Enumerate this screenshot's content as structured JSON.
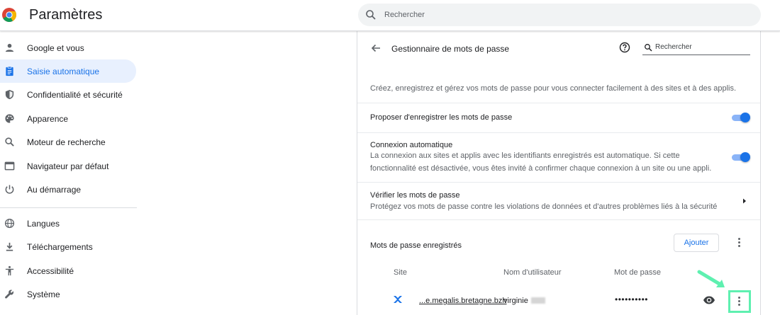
{
  "header": {
    "title": "Paramètres",
    "search_placeholder": "Rechercher"
  },
  "sidebar": {
    "items": [
      {
        "label": "Google et vous",
        "icon": "person-icon"
      },
      {
        "label": "Saisie automatique",
        "icon": "clipboard-icon",
        "active": true
      },
      {
        "label": "Confidentialité et sécurité",
        "icon": "shield-icon"
      },
      {
        "label": "Apparence",
        "icon": "palette-icon"
      },
      {
        "label": "Moteur de recherche",
        "icon": "search-icon"
      },
      {
        "label": "Navigateur par défaut",
        "icon": "browser-icon"
      },
      {
        "label": "Au démarrage",
        "icon": "power-icon"
      },
      {
        "label": "Langues",
        "icon": "globe-icon"
      },
      {
        "label": "Téléchargements",
        "icon": "download-icon"
      },
      {
        "label": "Accessibilité",
        "icon": "accessibility-icon"
      },
      {
        "label": "Système",
        "icon": "wrench-icon"
      }
    ]
  },
  "passwords": {
    "title": "Gestionnaire de mots de passe",
    "search_placeholder": "Rechercher",
    "description": "Créez, enregistrez et gérez vos mots de passe pour vous connecter facilement à des sites et à des applis.",
    "offer_to_save": {
      "label": "Proposer d'enregistrer les mots de passe",
      "enabled": true
    },
    "auto_signin": {
      "label": "Connexion automatique",
      "sub_line1": "La connexion aux sites et applis avec les identifiants enregistrés est automatique. Si cette",
      "sub_line2": "fonctionnalité est désactivée, vous êtes invité à confirmer chaque connexion à un site ou une appli.",
      "enabled": true
    },
    "check": {
      "label": "Vérifier les mots de passe",
      "sub": "Protégez vos mots de passe contre les violations de données et d'autres problèmes liés à la sécurité"
    },
    "saved_section_title": "Mots de passe enregistrés",
    "add_button": "Ajouter",
    "columns": {
      "site": "Site",
      "username": "Nom d'utilisateur",
      "password": "Mot de passe"
    },
    "entries": [
      {
        "site": "...e.megalis.bretagne.bzh",
        "username": "virginie",
        "password": "••••••••••"
      }
    ]
  },
  "colors": {
    "accent": "#1a73e8",
    "active_nav_bg": "#e8f0fe",
    "highlight": "#5ef0b0"
  }
}
